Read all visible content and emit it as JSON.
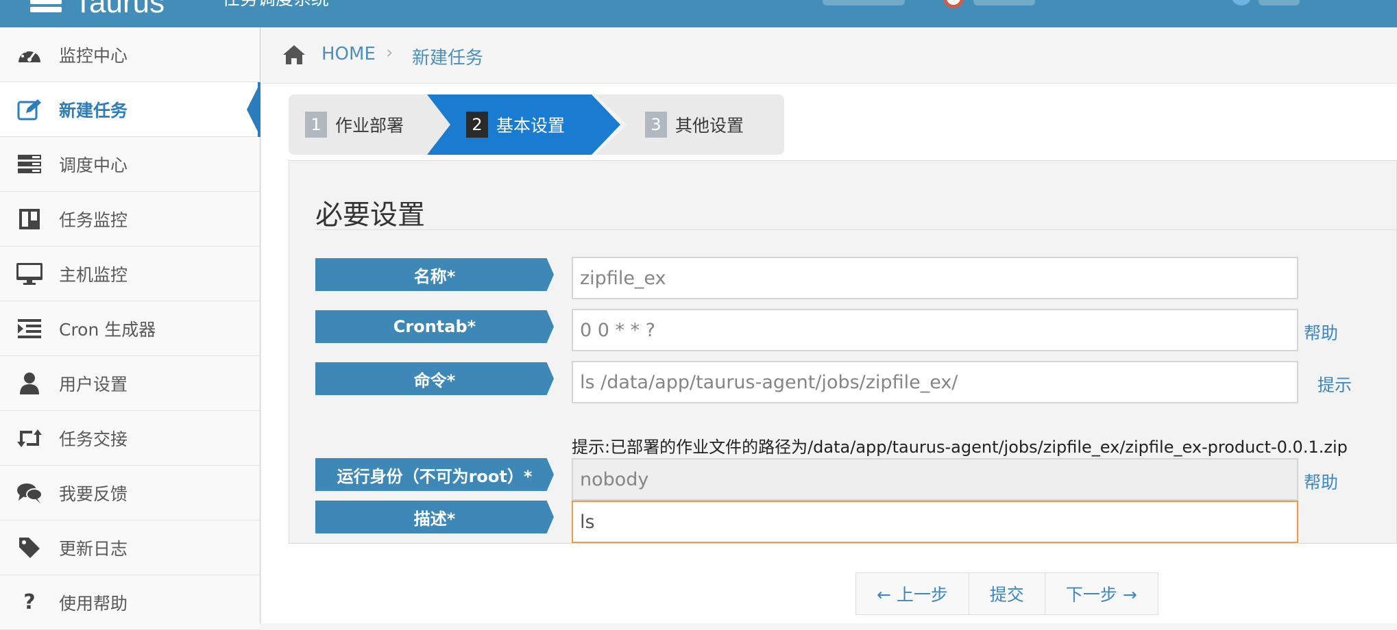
{
  "header": {
    "brand": "Taurus",
    "subtitle": "任务调度系统"
  },
  "sidebar": {
    "items": [
      {
        "label": "监控中心",
        "icon": "dashboard-icon"
      },
      {
        "label": "新建任务",
        "icon": "edit-icon",
        "active": true
      },
      {
        "label": "调度中心",
        "icon": "tasks-icon"
      },
      {
        "label": "任务监控",
        "icon": "trello-icon"
      },
      {
        "label": "主机监控",
        "icon": "desktop-icon"
      },
      {
        "label": "Cron 生成器",
        "icon": "indent-icon"
      },
      {
        "label": "用户设置",
        "icon": "user-icon"
      },
      {
        "label": "任务交接",
        "icon": "retweet-icon"
      },
      {
        "label": "我要反馈",
        "icon": "comments-icon"
      },
      {
        "label": "更新日志",
        "icon": "tag-icon"
      },
      {
        "label": "使用帮助",
        "icon": "question-icon"
      }
    ]
  },
  "breadcrumb": {
    "home": "HOME",
    "separator": "›",
    "current": "新建任务"
  },
  "wizard": {
    "steps": [
      {
        "num": "1",
        "label": "作业部署"
      },
      {
        "num": "2",
        "label": "基本设置",
        "active": true
      },
      {
        "num": "3",
        "label": "其他设置"
      }
    ]
  },
  "form": {
    "title": "必要设置",
    "name": {
      "label": "名称*",
      "value": "zipfile_ex"
    },
    "crontab": {
      "label": "Crontab*",
      "value": "0 0 * * ?",
      "link": "帮助"
    },
    "command": {
      "label": "命令*",
      "value": "ls /data/app/taurus-agent/jobs/zipfile_ex/",
      "link": "提示"
    },
    "hint": "提示:已部署的作业文件的路径为/data/app/taurus-agent/jobs/zipfile_ex/zipfile_ex-product-0.0.1.zip",
    "run_as": {
      "label": "运行身份（不可为root）*",
      "value": "nobody",
      "link": "帮助"
    },
    "description": {
      "label": "描述*",
      "value": "ls"
    }
  },
  "pager": {
    "prev": "← 上一步",
    "submit": "提交",
    "next": "下一步 →"
  },
  "colors": {
    "header_bg": "#438eb9",
    "accent": "#2b7dbc",
    "label_bg": "#3e88b7",
    "link": "#3c87c1",
    "focus_border": "#f59942"
  }
}
